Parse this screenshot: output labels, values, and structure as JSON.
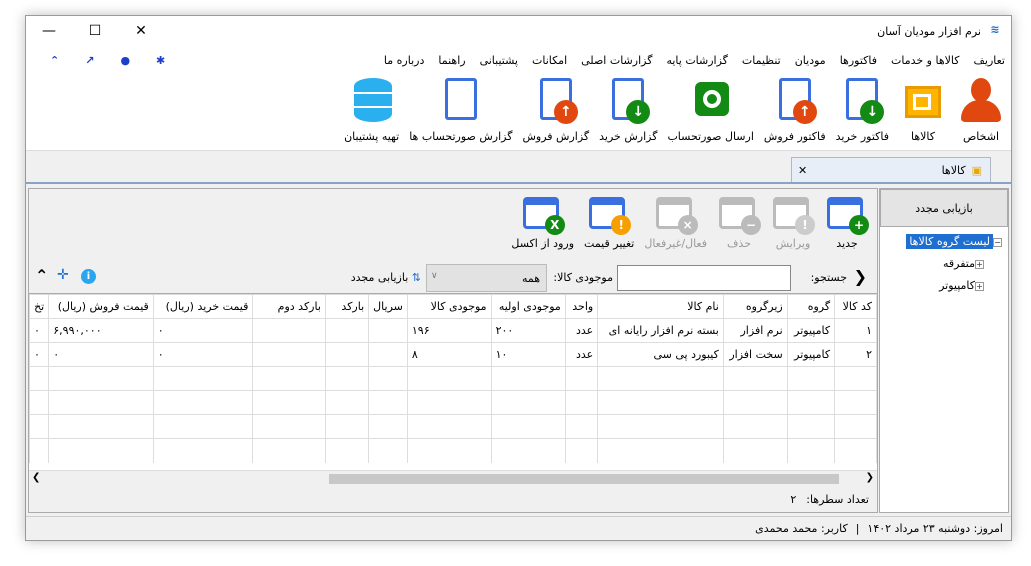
{
  "window": {
    "title": "نرم افزار مودیان آسان",
    "minimize": "—",
    "maximize": "☐",
    "close": "✕"
  },
  "menu": [
    "تعاریف",
    "کالاها و خدمات",
    "فاکتورها",
    "مودیان",
    "تنظیمات",
    "گزارشات پایه",
    "گزارشات اصلی",
    "امکانات",
    "پشتیبانی",
    "راهنما",
    "درباره ما"
  ],
  "ribbon": [
    {
      "label": "اشخاص",
      "icon": "person-icon"
    },
    {
      "label": "کالاها",
      "icon": "box-icon"
    },
    {
      "label": "فاکتور خرید",
      "icon": "purchase-invoice-icon"
    },
    {
      "label": "فاکتور فروش",
      "icon": "sales-invoice-icon"
    },
    {
      "label": "ارسال صورتحساب",
      "icon": "gear-send-icon"
    },
    {
      "label": "گزارش خرید",
      "icon": "purchase-report-icon"
    },
    {
      "label": "گزارش فروش",
      "icon": "sales-report-icon"
    },
    {
      "label": "گزارش صورتحساب ها",
      "icon": "invoice-report-icon"
    },
    {
      "label": "تهیه پشتیبان",
      "icon": "database-icon"
    }
  ],
  "tab": {
    "label": "کالاها",
    "close": "✕"
  },
  "tree": {
    "refresh": "بازیابی مجدد",
    "root": "لیست گروه کالاها",
    "children": [
      "متفرقه",
      "کامپیوتر"
    ]
  },
  "toolbar": {
    "new": "جدید",
    "edit": "ویرایش",
    "delete": "حذف",
    "toggle": "فعال/غیرفعال",
    "price": "تغییر قیمت",
    "excel": "ورود از اکسل"
  },
  "filter": {
    "search_label": "جستجو:",
    "search_value": "",
    "stock_label": "موجودی کالا:",
    "stock_value": "همه",
    "refresh": "بازیابی مجدد"
  },
  "grid": {
    "columns": [
      "کد کالا",
      "گروه",
      "زیرگروه",
      "نام کالا",
      "واحد",
      "موجودی اولیه",
      "موجودی کالا",
      "سریال",
      "بارکد",
      "بارکد دوم",
      "قیمت خرید (ریال)",
      "قیمت فروش (ریال)",
      "تخ"
    ],
    "rows": [
      [
        "۱",
        "کامپیوتر",
        "نرم افزار",
        "بسته نرم افزار رایانه ای",
        "عدد",
        "۲۰۰",
        "۱۹۶",
        "",
        "",
        "",
        "۰",
        "۶,۹۹۰,۰۰۰",
        "۰"
      ],
      [
        "۲",
        "کامپیوتر",
        "سخت افزار",
        "کیبورد پی سی",
        "عدد",
        "۱۰",
        "۸",
        "",
        "",
        "",
        "۰",
        "۰",
        "۰"
      ]
    ]
  },
  "footer": {
    "row_count_label": "تعداد سطرها:",
    "row_count": "۲"
  },
  "status": {
    "today": "امروز: دوشنبه ۲۳ مرداد ۱۴۰۲",
    "sep": "|",
    "user": "کاربر: محمد محمدی"
  }
}
